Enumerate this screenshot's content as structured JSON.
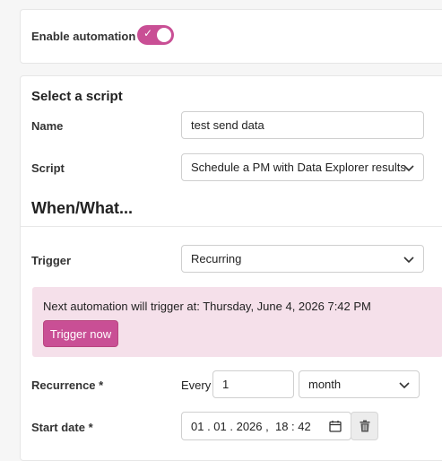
{
  "automation": {
    "label": "Enable automation",
    "enabled": true
  },
  "script_section": {
    "heading": "Select a script",
    "name_label": "Name",
    "name_value": "test send data",
    "script_label": "Script",
    "script_value": "Schedule a PM with Data Explorer results"
  },
  "when_section": {
    "heading": "When/What...",
    "trigger_label": "Trigger",
    "trigger_value": "Recurring",
    "banner_text": "Next automation will trigger at: Thursday, June 4, 2026 7:42 PM",
    "trigger_now_label": "Trigger now",
    "recurrence_label": "Recurrence *",
    "every_label": "Every",
    "recurrence_value": "1",
    "recurrence_unit": "month",
    "start_date_label": "Start date *",
    "start_date_value": "01 . 01 . 2026 ,  18 : 42"
  },
  "icons": [
    "check-icon",
    "chevron-down-icon",
    "calendar-icon",
    "trash-icon"
  ],
  "colors": {
    "accent": "#c94f95",
    "banner_bg": "#f5e0ea"
  }
}
